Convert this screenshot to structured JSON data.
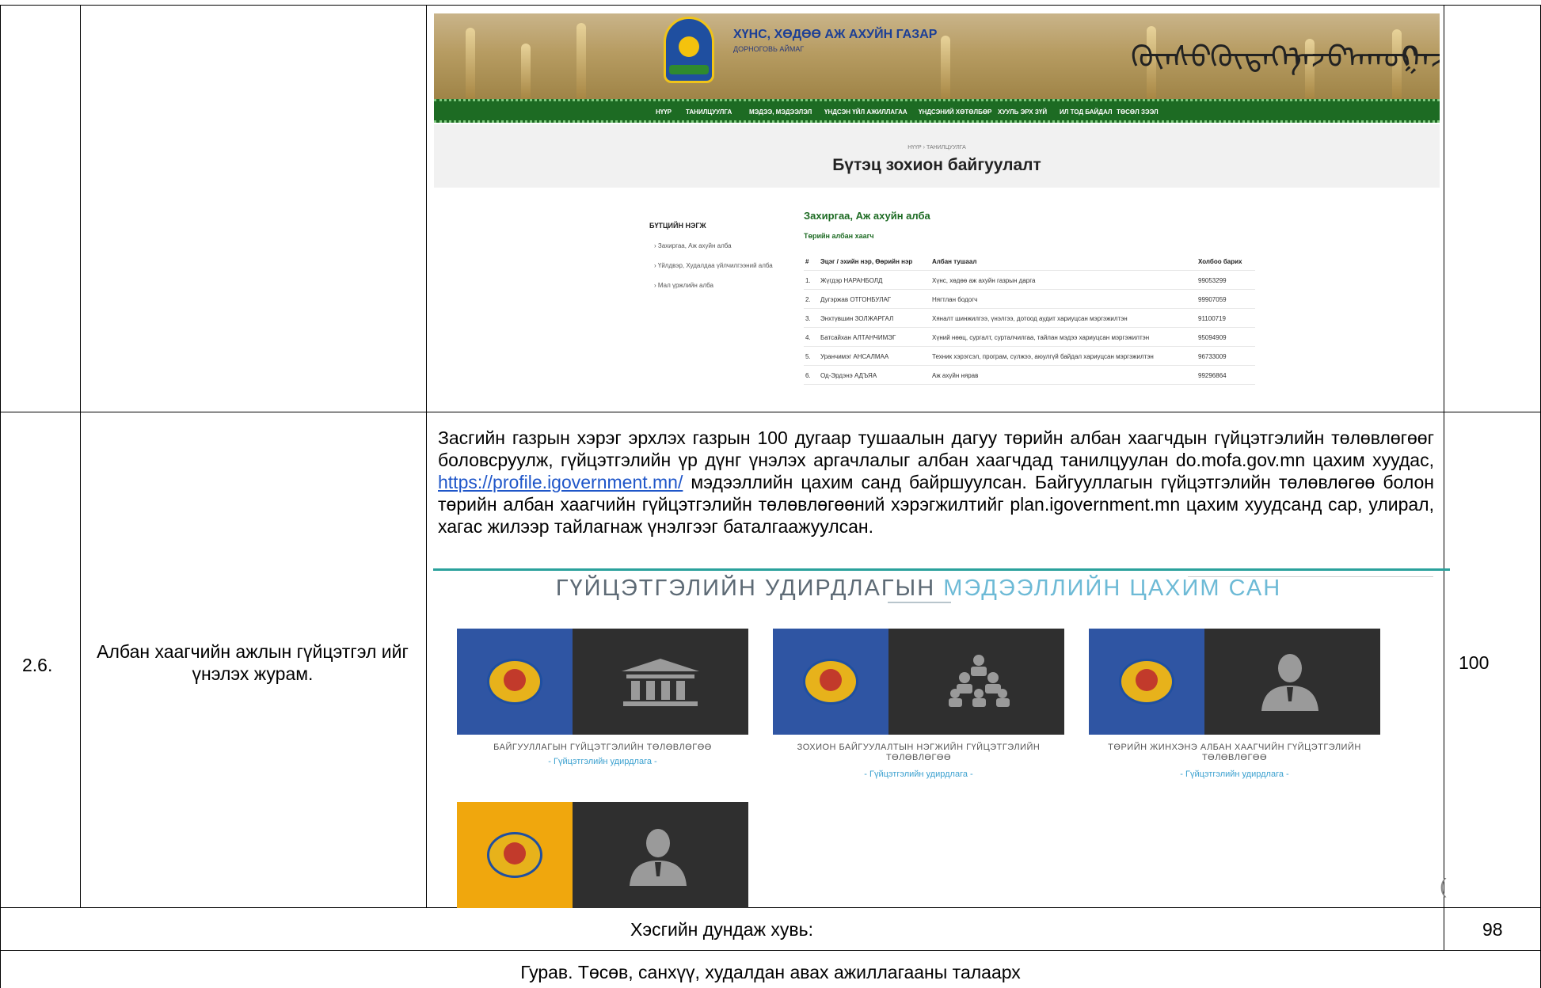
{
  "embedded_site": {
    "org_title": "ХҮНС, ХӨДӨӨ АЖ АХУЙН ГАЗАР",
    "org_sub": "ДОРНОГОВЬ АЙМАГ",
    "menu": [
      "НҮҮР",
      "ТАНИЛЦУУЛГА",
      "МЭДЭЭ, МЭДЭЭЛЭЛ",
      "ҮНДСЭН ҮЙЛ АЖИЛЛАГАА",
      "ҮНДСЭНИЙ ХӨТӨЛБӨР",
      "ХУУЛЬ ЭРХ ЗҮЙ",
      "ИЛ ТОД БАЙДАЛ",
      "ТӨСӨЛ ЗЭЭЛ"
    ],
    "breadcrumb": "НҮҮР  ›  ТАНИЛЦУУЛГА",
    "page_title": "Бүтэц зохион байгуулалт",
    "side_heading": "БҮТЦИЙН НЭГЖ",
    "side_items": [
      "› Захиргаа, Аж ахуйн алба",
      "› Үйлдвэр, Худалдаа үйлчилгээний алба",
      "› Мал үржлийн алба"
    ],
    "section_title": "Захиргаа, Аж ахуйн алба",
    "section_sub": "Төрийн албан хаагч",
    "table_head": {
      "num": "#",
      "name": "Эцэг / эхийн нэр, Өөрийн нэр",
      "position": "Албан тушаал",
      "contact": "Холбоо барих"
    },
    "table_rows": [
      {
        "num": "1.",
        "name": "Жүгдэр НАРАНБОЛД",
        "position": "Хүнс, хөдөө аж ахуйн газрын дарга",
        "contact": "99053299"
      },
      {
        "num": "2.",
        "name": "Дугэржав ОТГОНБУЛАГ",
        "position": "Нягтлан бодогч",
        "contact": "99907059"
      },
      {
        "num": "3.",
        "name": "Энхтүвшин ЗОЛЖАРГАЛ",
        "position": "Хяналт шинжилгээ, үнэлгээ, дотоод аудит хариуцсан мэргэжилтэн",
        "contact": "91100719"
      },
      {
        "num": "4.",
        "name": "Батсайхан АЛТАНЧИМЭГ",
        "position": "Хүний нөөц, сургалт, сурталчилгаа, тайлан мэдээ хариуцсан мэргэжилтэн",
        "contact": "95094909"
      },
      {
        "num": "5.",
        "name": "Уранчимэг АНСАЛМАА",
        "position": "Техник хэрэгсэл, програм, сүлжээ, аюулгүй байдал хариуцсан мэргэжилтэн",
        "contact": "96733009"
      },
      {
        "num": "6.",
        "name": "Од-Эрдэнэ АДЪЯА",
        "position": "Аж ахуйн нярав",
        "contact": "99296864"
      }
    ]
  },
  "row_26": {
    "number": "2.6.",
    "criterion": "Албан хаагчийн ажлын гүйцэтгэл ийг үнэлэх журам.",
    "score": "100",
    "para_part1": " Засгийн газрын хэрэг эрхлэх газрын 100 дугаар тушаалын дагуу төрийн албан хаагчдын гүйцэтгэлийн төлөвлөгөөг боловсруулж, гүйцэтгэлийн үр дүнг үнэлэх аргачлалыг   албан хаагчдад танилцуулан  do.mofa.gov.mn  цахим хуудас, ",
    "para_link": "https://profile.igovernment.mn/",
    "para_part2": " мэдээллийн цахим санд байршуулсан.   Байгууллагын гүйцэтгэлийн төлөвлөгөө болон төрийн албан хаагчийн гүйцэтгэлийн төлөвлөгөөний хэрэгжилтийг plan.igovernment.mn цахим хуудсанд сар, улирал, хагас жилээр тайлагнаж  үнэлгээг баталгаажуулсан.",
    "perf_title_a": "ГҮЙЦЭТГЭЛИЙН УДИРДЛАГЫН ",
    "perf_title_b": "МЭДЭЭЛЛИЙН ЦАХИМ САН",
    "cards": [
      {
        "caption": "БАЙГУУЛЛАГЫН ГҮЙЦЭТГЭЛИЙН ТӨЛӨВЛӨГӨӨ",
        "link": "- Гүйцэтгэлийн удирдлага -",
        "icon": "building-icon"
      },
      {
        "caption": "ЗОХИОН БАЙГУУЛАЛТЫН НЭГЖИЙН ГҮЙЦЭТГЭЛИЙН ТӨЛӨВЛӨГӨӨ",
        "link": "- Гүйцэтгэлийн удирдлага -",
        "icon": "group-icon"
      },
      {
        "caption": "ТӨРИЙН ЖИНХЭНЭ АЛБАН ХААГЧИЙН ГҮЙЦЭТГЭЛИЙН ТӨЛӨВЛӨГӨӨ",
        "link": "- Гүйцэтгэлийн удирдлага -",
        "icon": "person-icon"
      },
      {
        "caption": "",
        "link": "",
        "icon": "person-icon"
      }
    ]
  },
  "average_row": {
    "label": "Хэсгийн дундаж хувь:",
    "value": "98"
  },
  "section_row": {
    "label": "Гурав. Төсөв, санхүү, худалдан авах ажиллагааны талаарх"
  },
  "colors": {
    "menu_green": "#1d6b23",
    "seal_blue": "#2f55a3",
    "seal_gold": "#f0a70d",
    "teal": "#2aa19c",
    "link_blue": "#1f56c9"
  }
}
